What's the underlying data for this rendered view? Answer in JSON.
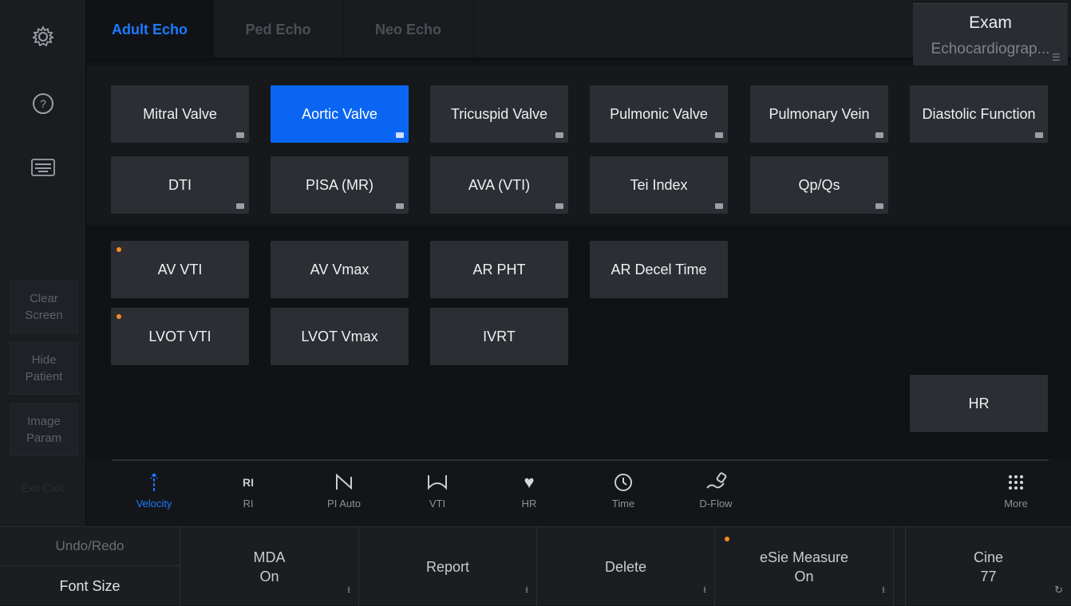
{
  "left_rail": {
    "icons": [
      "gear-icon",
      "help-icon",
      "keyboard-icon"
    ],
    "buttons": [
      "Clear\nScreen",
      "Hide\nPatient",
      "Image\nParam"
    ],
    "extra": "Exit Calc"
  },
  "tabs": [
    "Adult Echo",
    "Ped Echo",
    "Neo Echo"
  ],
  "active_tab": "Adult Echo",
  "exam": {
    "title": "Exam",
    "value": "Echocardiograp..."
  },
  "folders": [
    "Mitral Valve",
    "Aortic Valve",
    "Tricuspid Valve",
    "Pulmonic Valve",
    "Pulmonary Vein",
    "Diastolic Function",
    "DTI",
    "PISA (MR)",
    "AVA (VTI)",
    "Tei Index",
    "Qp/Qs"
  ],
  "selected_folder": "Aortic Valve",
  "measurements": [
    "AV VTI",
    "AV Vmax",
    "AR PHT",
    "AR Decel Time",
    "LVOT VTI",
    "LVOT Vmax",
    "IVRT"
  ],
  "hr_button": "HR",
  "tools": [
    {
      "icon": "velocity-arrow-icon",
      "label": "Velocity"
    },
    {
      "icon": "ri-text-icon",
      "text": "RI",
      "label": "RI"
    },
    {
      "icon": "pi-auto-icon",
      "label": "PI Auto"
    },
    {
      "icon": "vti-icon",
      "label": "VTI"
    },
    {
      "icon": "heart-icon",
      "label": "HR"
    },
    {
      "icon": "clock-icon",
      "label": "Time"
    },
    {
      "icon": "d-flow-icon",
      "label": "D-Flow"
    },
    {
      "icon": "grid-more-icon",
      "label": "More"
    }
  ],
  "bottom": {
    "undo": "Undo/Redo",
    "font_size": "Font Size",
    "mda": {
      "label": "MDA",
      "value": "On"
    },
    "report": "Report",
    "delete": "Delete",
    "esie": {
      "label": "eSie Measure",
      "value": "On"
    },
    "cine": {
      "label": "Cine",
      "value": "77"
    }
  },
  "colors": {
    "accent": "#0a66f2",
    "indicator": "#ff8a1f"
  }
}
